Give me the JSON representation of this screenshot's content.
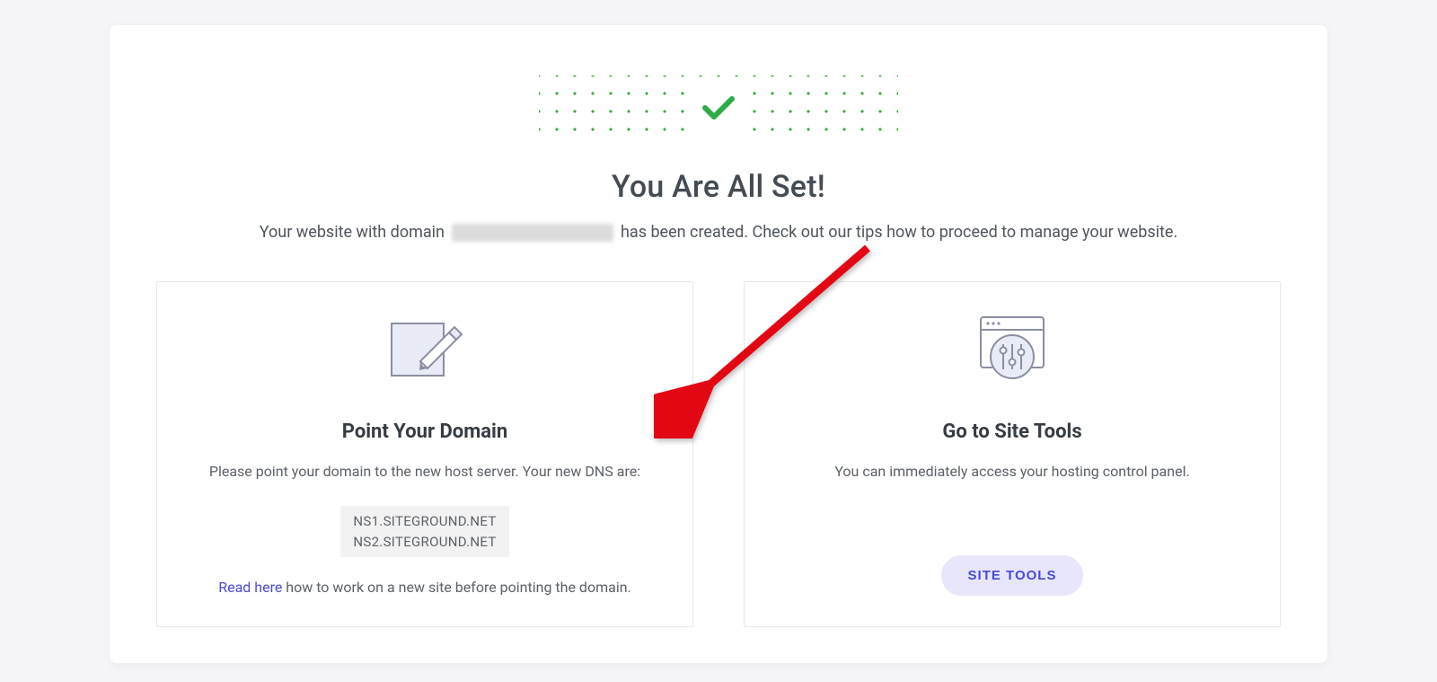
{
  "header": {
    "title": "You Are All Set!",
    "subtitle_before": "Your website with domain",
    "subtitle_after": "has been created. Check out our tips how to proceed to manage your website."
  },
  "cards": {
    "point_domain": {
      "title": "Point Your Domain",
      "description": "Please point your domain to the new host server. Your new DNS are:",
      "dns": [
        "NS1.SITEGROUND.NET",
        "NS2.SITEGROUND.NET"
      ],
      "footnote_link": "Read here",
      "footnote_text": " how to work on a new site before pointing the domain."
    },
    "site_tools": {
      "title": "Go to Site Tools",
      "description": "You can immediately access your hosting control panel.",
      "button_label": "SITE TOOLS"
    }
  },
  "colors": {
    "accent_green": "#2faa4a",
    "accent_purple": "#4b49da",
    "arrow_red": "#e30613"
  }
}
